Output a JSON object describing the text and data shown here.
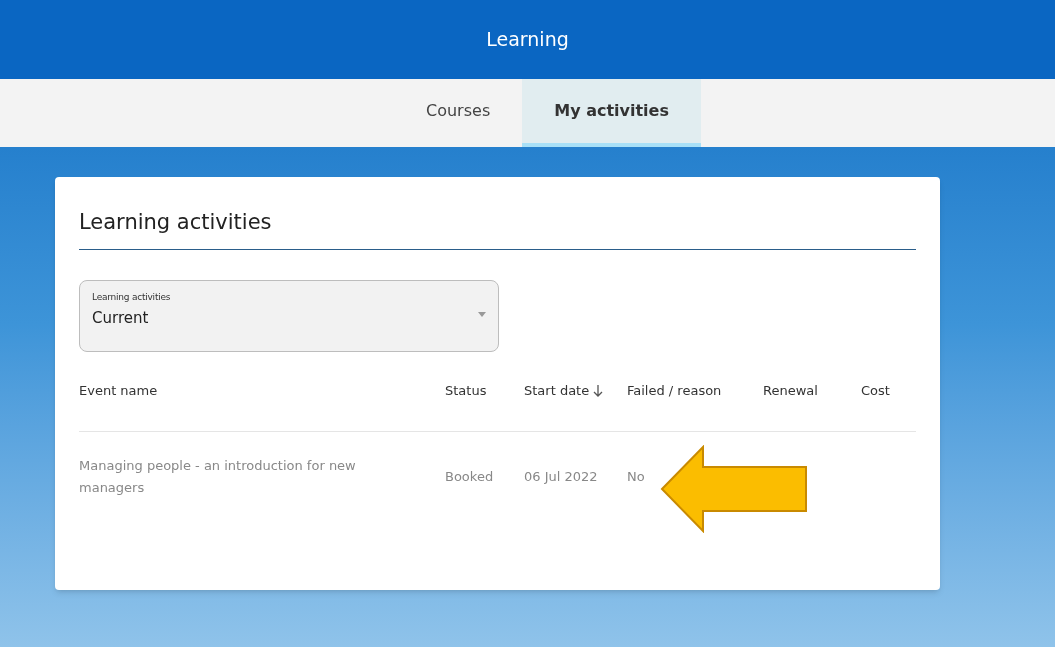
{
  "header": {
    "title": "Learning"
  },
  "tabs": [
    {
      "label": "Courses",
      "selected": false
    },
    {
      "label": "My activities",
      "selected": true
    }
  ],
  "card": {
    "title": "Learning activities",
    "filter": {
      "label": "Learning activities",
      "value": "Current"
    },
    "table": {
      "columns": [
        {
          "label": "Event name",
          "sorted": false
        },
        {
          "label": "Status",
          "sorted": false
        },
        {
          "label": "Start date",
          "sorted": true
        },
        {
          "label": "Failed / reason",
          "sorted": false
        },
        {
          "label": "Renewal",
          "sorted": false
        },
        {
          "label": "Cost",
          "sorted": false
        }
      ],
      "rows": [
        [
          "Managing people - an introduction for new managers",
          "Booked",
          "06 Jul 2022",
          "No"
        ]
      ]
    }
  },
  "annotation": {
    "kind": "arrow"
  }
}
